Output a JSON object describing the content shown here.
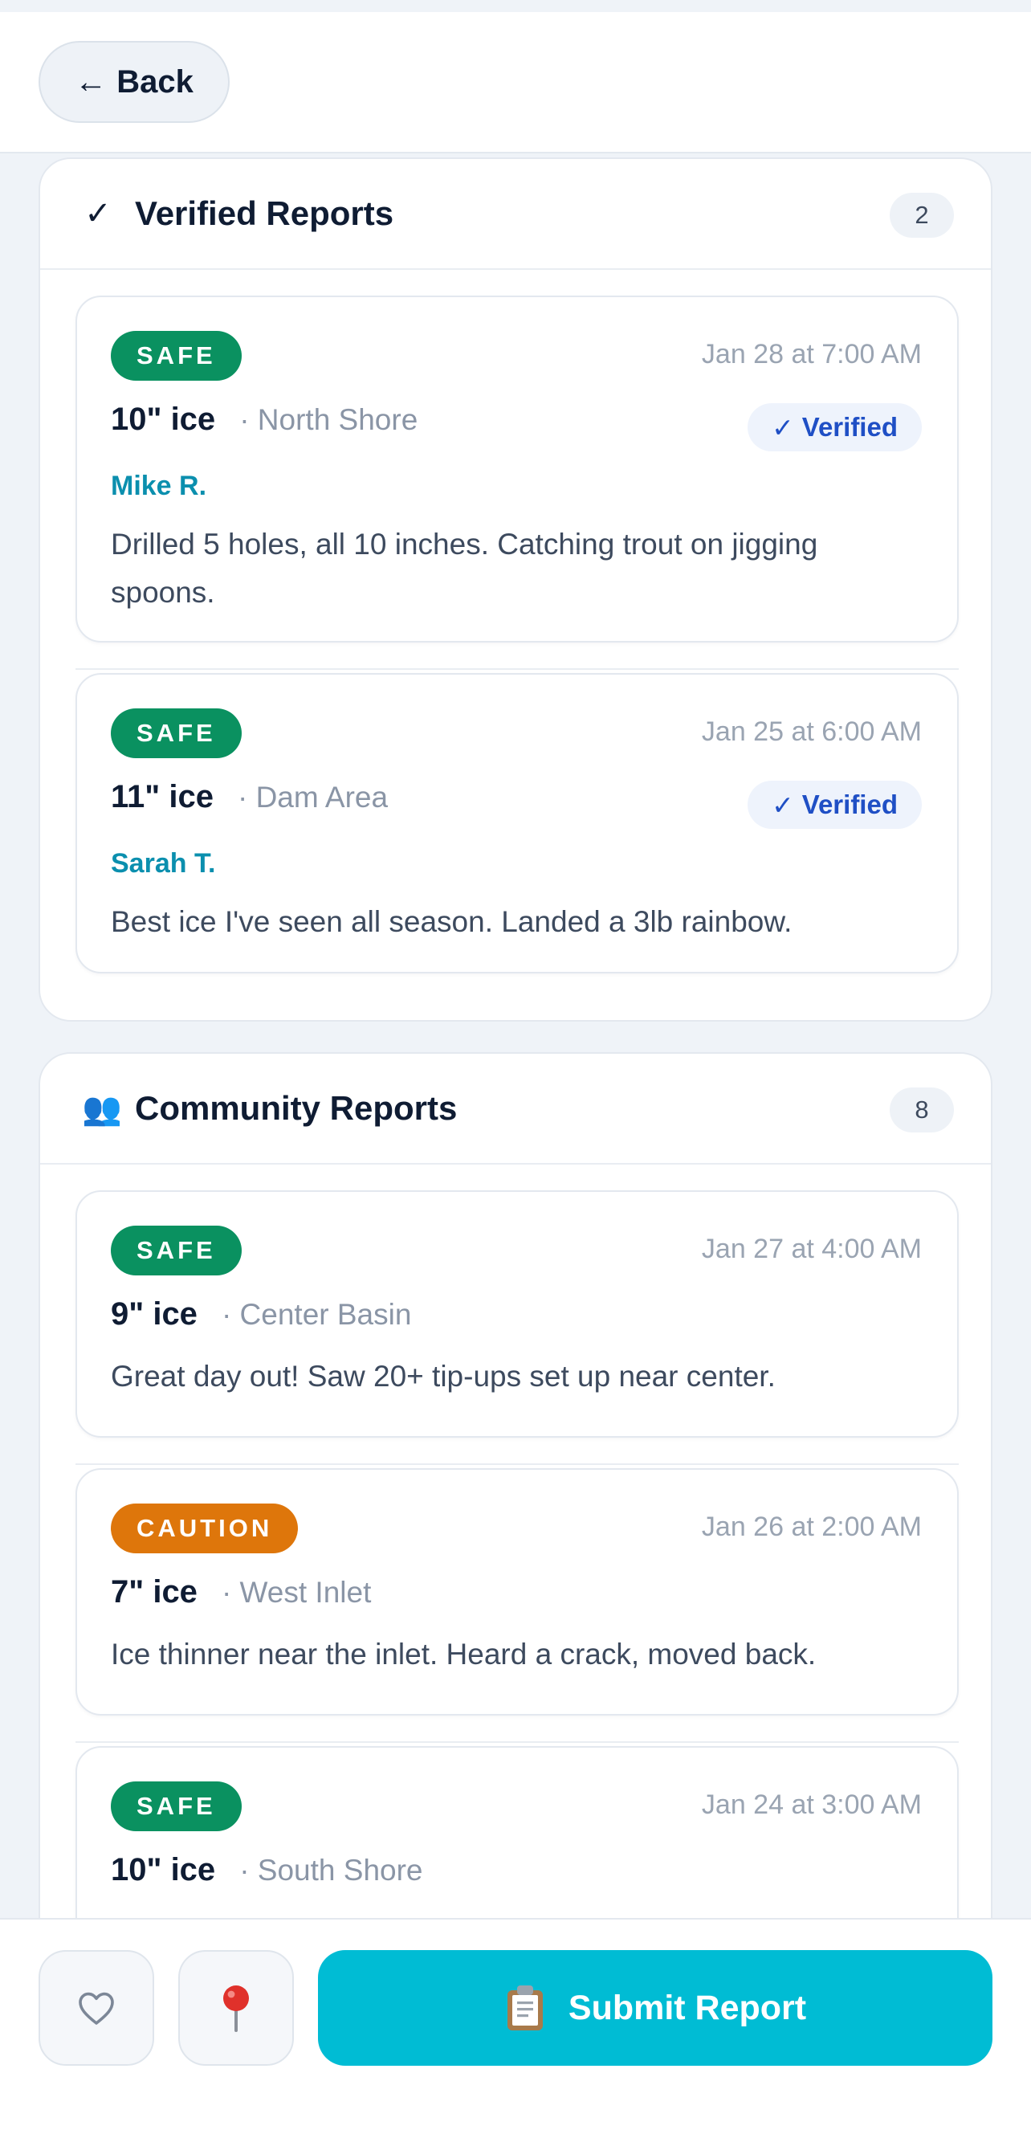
{
  "header": {
    "back_label": "Back",
    "back_icon": "arrow-left-icon"
  },
  "verified": {
    "title": "Verified Reports",
    "icon": "checkmark-icon",
    "count": "2",
    "reports": [
      {
        "status": "SAFE",
        "date": "Jan 28 at 7:00 AM",
        "ice": "10\" ice",
        "location": "· North Shore",
        "verified_label": "Verified",
        "author": "Mike R.",
        "note": "Drilled 5 holes, all 10 inches. Catching trout on jigging spoons."
      },
      {
        "status": "SAFE",
        "date": "Jan 25 at 6:00 AM",
        "ice": "11\" ice",
        "location": "· Dam Area",
        "verified_label": "Verified",
        "author": "Sarah T.",
        "note": "Best ice I've seen all season. Landed a 3lb rainbow."
      }
    ]
  },
  "community": {
    "title": "Community Reports",
    "icon": "people-icon",
    "count": "8",
    "reports": [
      {
        "status": "SAFE",
        "date": "Jan 27 at 4:00 AM",
        "ice": "9\" ice",
        "location": "· Center Basin",
        "note": "Great day out! Saw 20+ tip-ups set up near center."
      },
      {
        "status": "CAUTION",
        "date": "Jan 26 at 2:00 AM",
        "ice": "7\" ice",
        "location": "· West Inlet",
        "note": "Ice thinner near the inlet. Heard a crack, moved back."
      },
      {
        "status": "SAFE",
        "date": "Jan 24 at 3:00 AM",
        "ice": "10\" ice",
        "location": "· South Shore"
      }
    ]
  },
  "bottom": {
    "favorite_icon": "heart-icon",
    "map_icon": "pin-icon",
    "submit_label": "Submit Report",
    "submit_icon": "clipboard-icon"
  },
  "colors": {
    "safe": "#0a9160",
    "caution": "#de760b",
    "accent": "#00bcd4",
    "verified": "#1f4fc5",
    "author": "#0b8fae"
  }
}
